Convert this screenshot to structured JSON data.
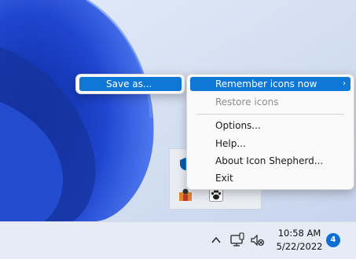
{
  "save_menu": {
    "save_as_label": "Save as..."
  },
  "context_menu": {
    "items": [
      {
        "label": "Remember icons now",
        "state": "highlighted",
        "has_submenu": true
      },
      {
        "label": "Restore icons",
        "state": "disabled"
      },
      {
        "label": "Options..."
      },
      {
        "label": "Help..."
      },
      {
        "label": "About Icon Shepherd..."
      },
      {
        "label": "Exit"
      }
    ]
  },
  "taskbar": {
    "time": "10:58 AM",
    "date": "5/22/2022",
    "notification_count": "4"
  },
  "colors": {
    "highlight": "#0f77d6",
    "wallpaper_blue": "#1a3ec0",
    "badge": "#0f6fd0"
  },
  "icons": [
    "chevron-up-icon",
    "network-icon",
    "volume-muted-icon",
    "windows-defender-icon",
    "app-tray-icon",
    "paw-icon",
    "submenu-arrow-icon"
  ]
}
